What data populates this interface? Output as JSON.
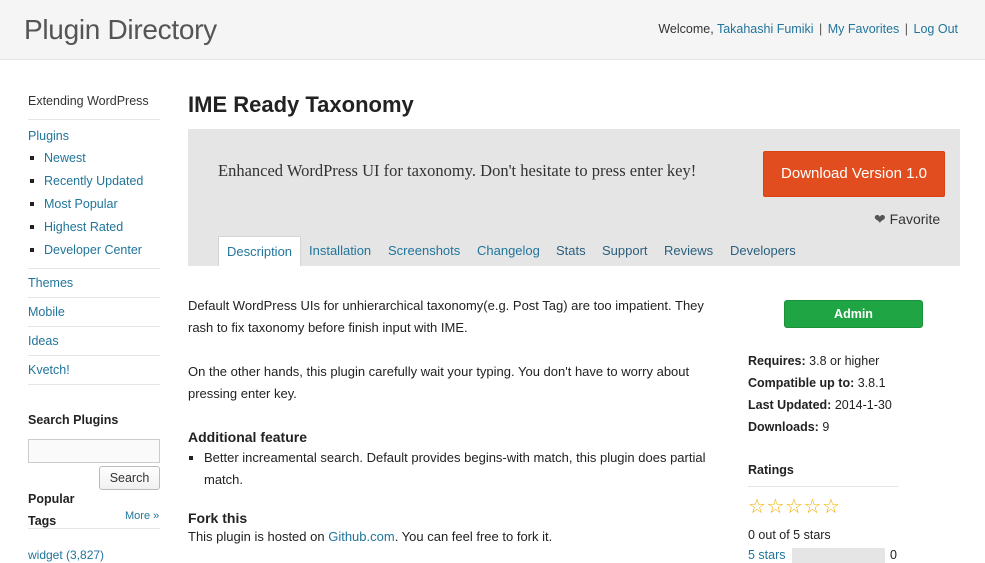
{
  "header": {
    "site_title": "Plugin Directory",
    "welcome": "Welcome,",
    "username": "Takahashi Fumiki",
    "favorites": "My Favorites",
    "logout": "Log Out",
    "sep": "|"
  },
  "sidebar": {
    "heading": "Extending WordPress",
    "plugins": "Plugins",
    "sub_items": [
      "Newest",
      "Recently Updated",
      "Most Popular",
      "Highest Rated",
      "Developer Center"
    ],
    "links": [
      "Themes",
      "Mobile",
      "Ideas",
      "Kvetch!"
    ],
    "search_title": "Search Plugins",
    "search_button": "Search",
    "popular_title_1": "Popular",
    "popular_title_2": "Tags",
    "more": "More »",
    "tag": "widget (3,827)"
  },
  "plugin": {
    "title": "IME Ready Taxonomy",
    "short_desc": "Enhanced WordPress UI for taxonomy. Don't hesitate to press enter key!",
    "download": "Download Version 1.0",
    "favorite": "Favorite",
    "favorite_icon": "heart-icon",
    "tabs": [
      "Description",
      "Installation",
      "Screenshots",
      "Changelog",
      "Stats",
      "Support",
      "Reviews",
      "Developers"
    ]
  },
  "content": {
    "p1": "Default WordPress UIs for unhierarchical taxonomy(e.g. Post Tag) are too impatient. They rash to fix taxonomy before finish input with IME.",
    "p2": "On the other hands, this plugin carefully wait your typing. You don't have to worry about pressing enter key.",
    "h_additional": "Additional feature",
    "feature": "Better increamental search. Default provides begins-with match, this plugin does partial match.",
    "h_fork": "Fork this",
    "fork_pre": "This plugin is hosted on ",
    "fork_link": "Github.com",
    "fork_post": ". You can feel free to fork it."
  },
  "meta": {
    "admin": "Admin",
    "requires_label": "Requires:",
    "requires_value": "3.8 or higher",
    "compat_label": "Compatible up to:",
    "compat_value": "3.8.1",
    "updated_label": "Last Updated:",
    "updated_value": "2014-1-30",
    "downloads_label": "Downloads:",
    "downloads_value": "9",
    "ratings_title": "Ratings",
    "stars_text": "0 out of 5 stars",
    "rating_rows": [
      {
        "label": "5 stars",
        "count": "0"
      }
    ]
  },
  "colors": {
    "link": "#21759b",
    "download_btn": "#e14d1e",
    "admin_btn": "#1fa544",
    "star": "#f0b000"
  }
}
